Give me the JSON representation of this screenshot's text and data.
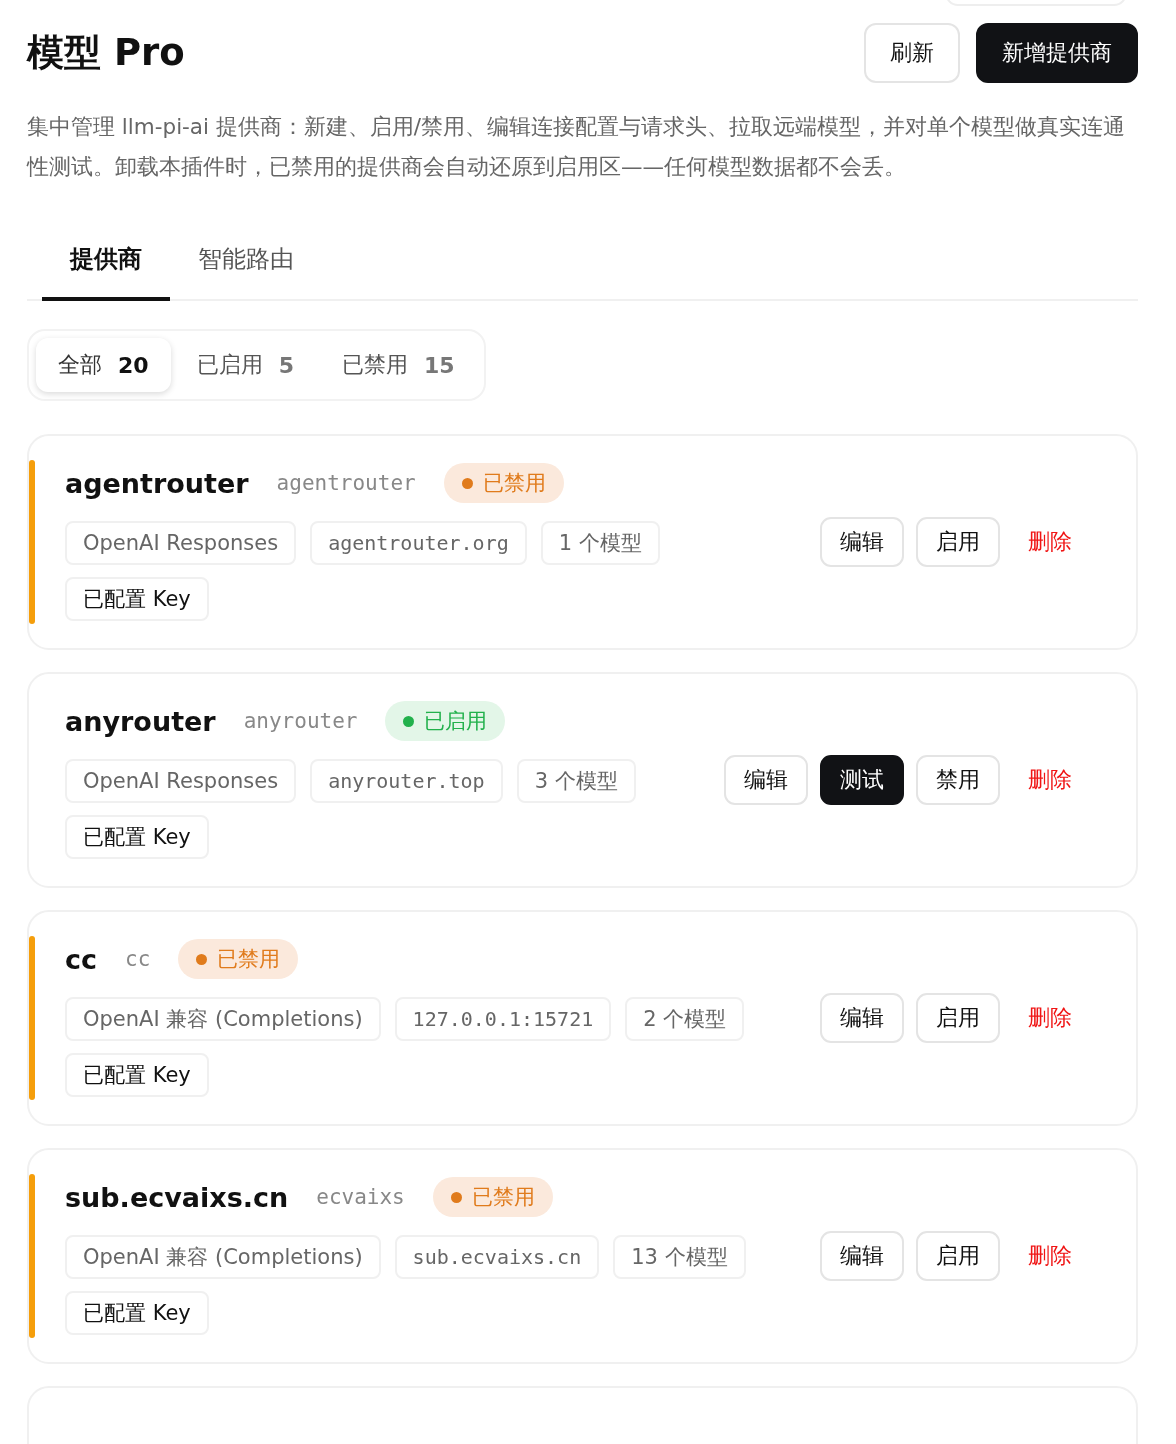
{
  "header": {
    "title": "模型 Pro",
    "buttons": [
      {
        "label": "刷新",
        "kind": "outline"
      },
      {
        "label": "新增提供商",
        "kind": "primary"
      }
    ]
  },
  "description": "集中管理 llm-pi-ai 提供商：新建、启用/禁用、编辑连接配置与请求头、拉取远端模型，并对单个模型做真实连通性测试。卸载本插件时，已禁用的提供商会自动还原到启用区——任何模型数据都不会丢。",
  "tabs": [
    {
      "label": "提供商",
      "selected": true
    },
    {
      "label": "智能路由",
      "selected": false
    }
  ],
  "filters": [
    {
      "label": "全部",
      "count": "20",
      "selected": true
    },
    {
      "label": "已启用",
      "count": "5",
      "selected": false
    },
    {
      "label": "已禁用",
      "count": "15",
      "selected": false
    }
  ],
  "providers": [
    {
      "name": "agentrouter",
      "slug": "agentrouter",
      "enabled": false,
      "status": "已禁用",
      "chips": [
        {
          "text": "OpenAI Responses",
          "kind": "text"
        },
        {
          "text": "agentrouter.org",
          "kind": "mono"
        },
        {
          "text": "1 个模型",
          "kind": "text"
        },
        {
          "text": "已配置 Key",
          "kind": "key"
        }
      ],
      "actions": [
        {
          "label": "编辑",
          "kind": "outline"
        },
        {
          "label": "启用",
          "kind": "outline"
        },
        {
          "label": "删除",
          "kind": "danger"
        }
      ]
    },
    {
      "name": "anyrouter",
      "slug": "anyrouter",
      "enabled": true,
      "status": "已启用",
      "chips": [
        {
          "text": "OpenAI Responses",
          "kind": "text"
        },
        {
          "text": "anyrouter.top",
          "kind": "mono"
        },
        {
          "text": "3 个模型",
          "kind": "text"
        },
        {
          "text": "已配置 Key",
          "kind": "key"
        }
      ],
      "actions": [
        {
          "label": "编辑",
          "kind": "outline"
        },
        {
          "label": "测试",
          "kind": "primary"
        },
        {
          "label": "禁用",
          "kind": "outline"
        },
        {
          "label": "删除",
          "kind": "danger"
        }
      ]
    },
    {
      "name": "cc",
      "slug": "cc",
      "enabled": false,
      "status": "已禁用",
      "chips": [
        {
          "text": "OpenAI 兼容 (Completions)",
          "kind": "text"
        },
        {
          "text": "127.0.0.1:15721",
          "kind": "mono"
        },
        {
          "text": "2 个模型",
          "kind": "text"
        },
        {
          "text": "已配置 Key",
          "kind": "key"
        }
      ],
      "actions": [
        {
          "label": "编辑",
          "kind": "outline"
        },
        {
          "label": "启用",
          "kind": "outline"
        },
        {
          "label": "删除",
          "kind": "danger"
        }
      ]
    },
    {
      "name": "sub.ecvaixs.cn",
      "slug": "ecvaixs",
      "enabled": false,
      "status": "已禁用",
      "chips": [
        {
          "text": "OpenAI 兼容 (Completions)",
          "kind": "text"
        },
        {
          "text": "sub.ecvaixs.cn",
          "kind": "mono"
        },
        {
          "text": "13 个模型",
          "kind": "text"
        },
        {
          "text": "已配置 Key",
          "kind": "key"
        }
      ],
      "actions": [
        {
          "label": "编辑",
          "kind": "outline"
        },
        {
          "label": "启用",
          "kind": "outline"
        },
        {
          "label": "删除",
          "kind": "danger"
        }
      ]
    }
  ]
}
